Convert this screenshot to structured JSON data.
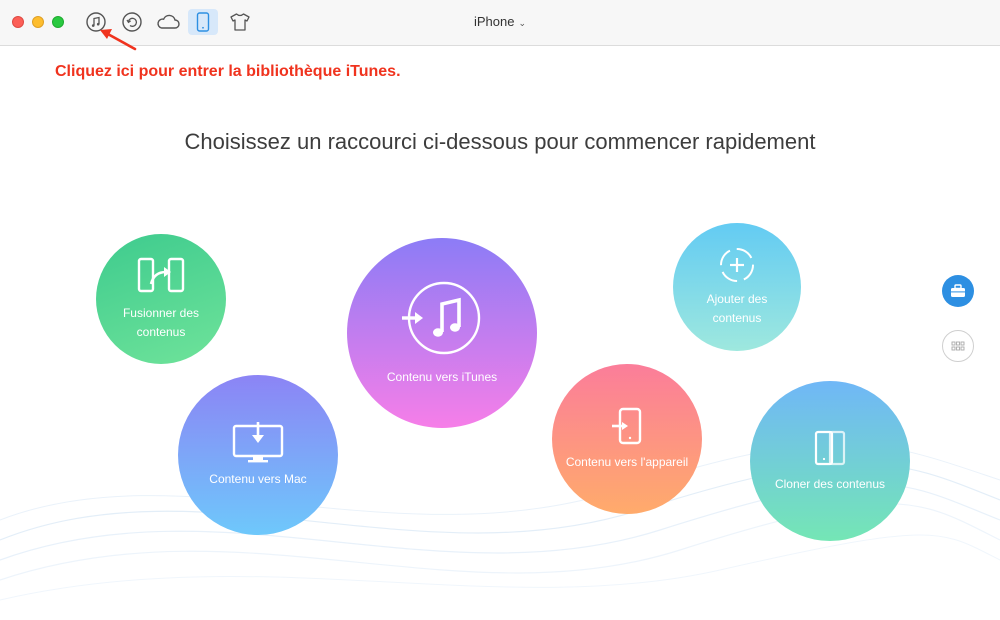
{
  "window": {
    "device_name": "iPhone",
    "toolbar_icons": [
      "itunes-library-icon",
      "restore-icon",
      "cloud-icon",
      "device-icon",
      "shirt-icon"
    ]
  },
  "annotation": {
    "text": "Cliquez ici pour entrer la bibliothèque iTunes."
  },
  "main": {
    "heading": "Choisissez un raccourci ci-dessous pour commencer rapidement",
    "shortcuts": {
      "merge": "Fusionner des contenus",
      "to_mac": "Contenu vers Mac",
      "to_itunes": "Contenu vers iTunes",
      "add": "Ajouter des contenus",
      "to_device": "Contenu vers l'appareil",
      "clone": "Cloner des contenus"
    }
  },
  "colors": {
    "annotation": "#f0331e",
    "accent": "#2d8fe2",
    "active_tab_bg": "#d7e8fa"
  }
}
